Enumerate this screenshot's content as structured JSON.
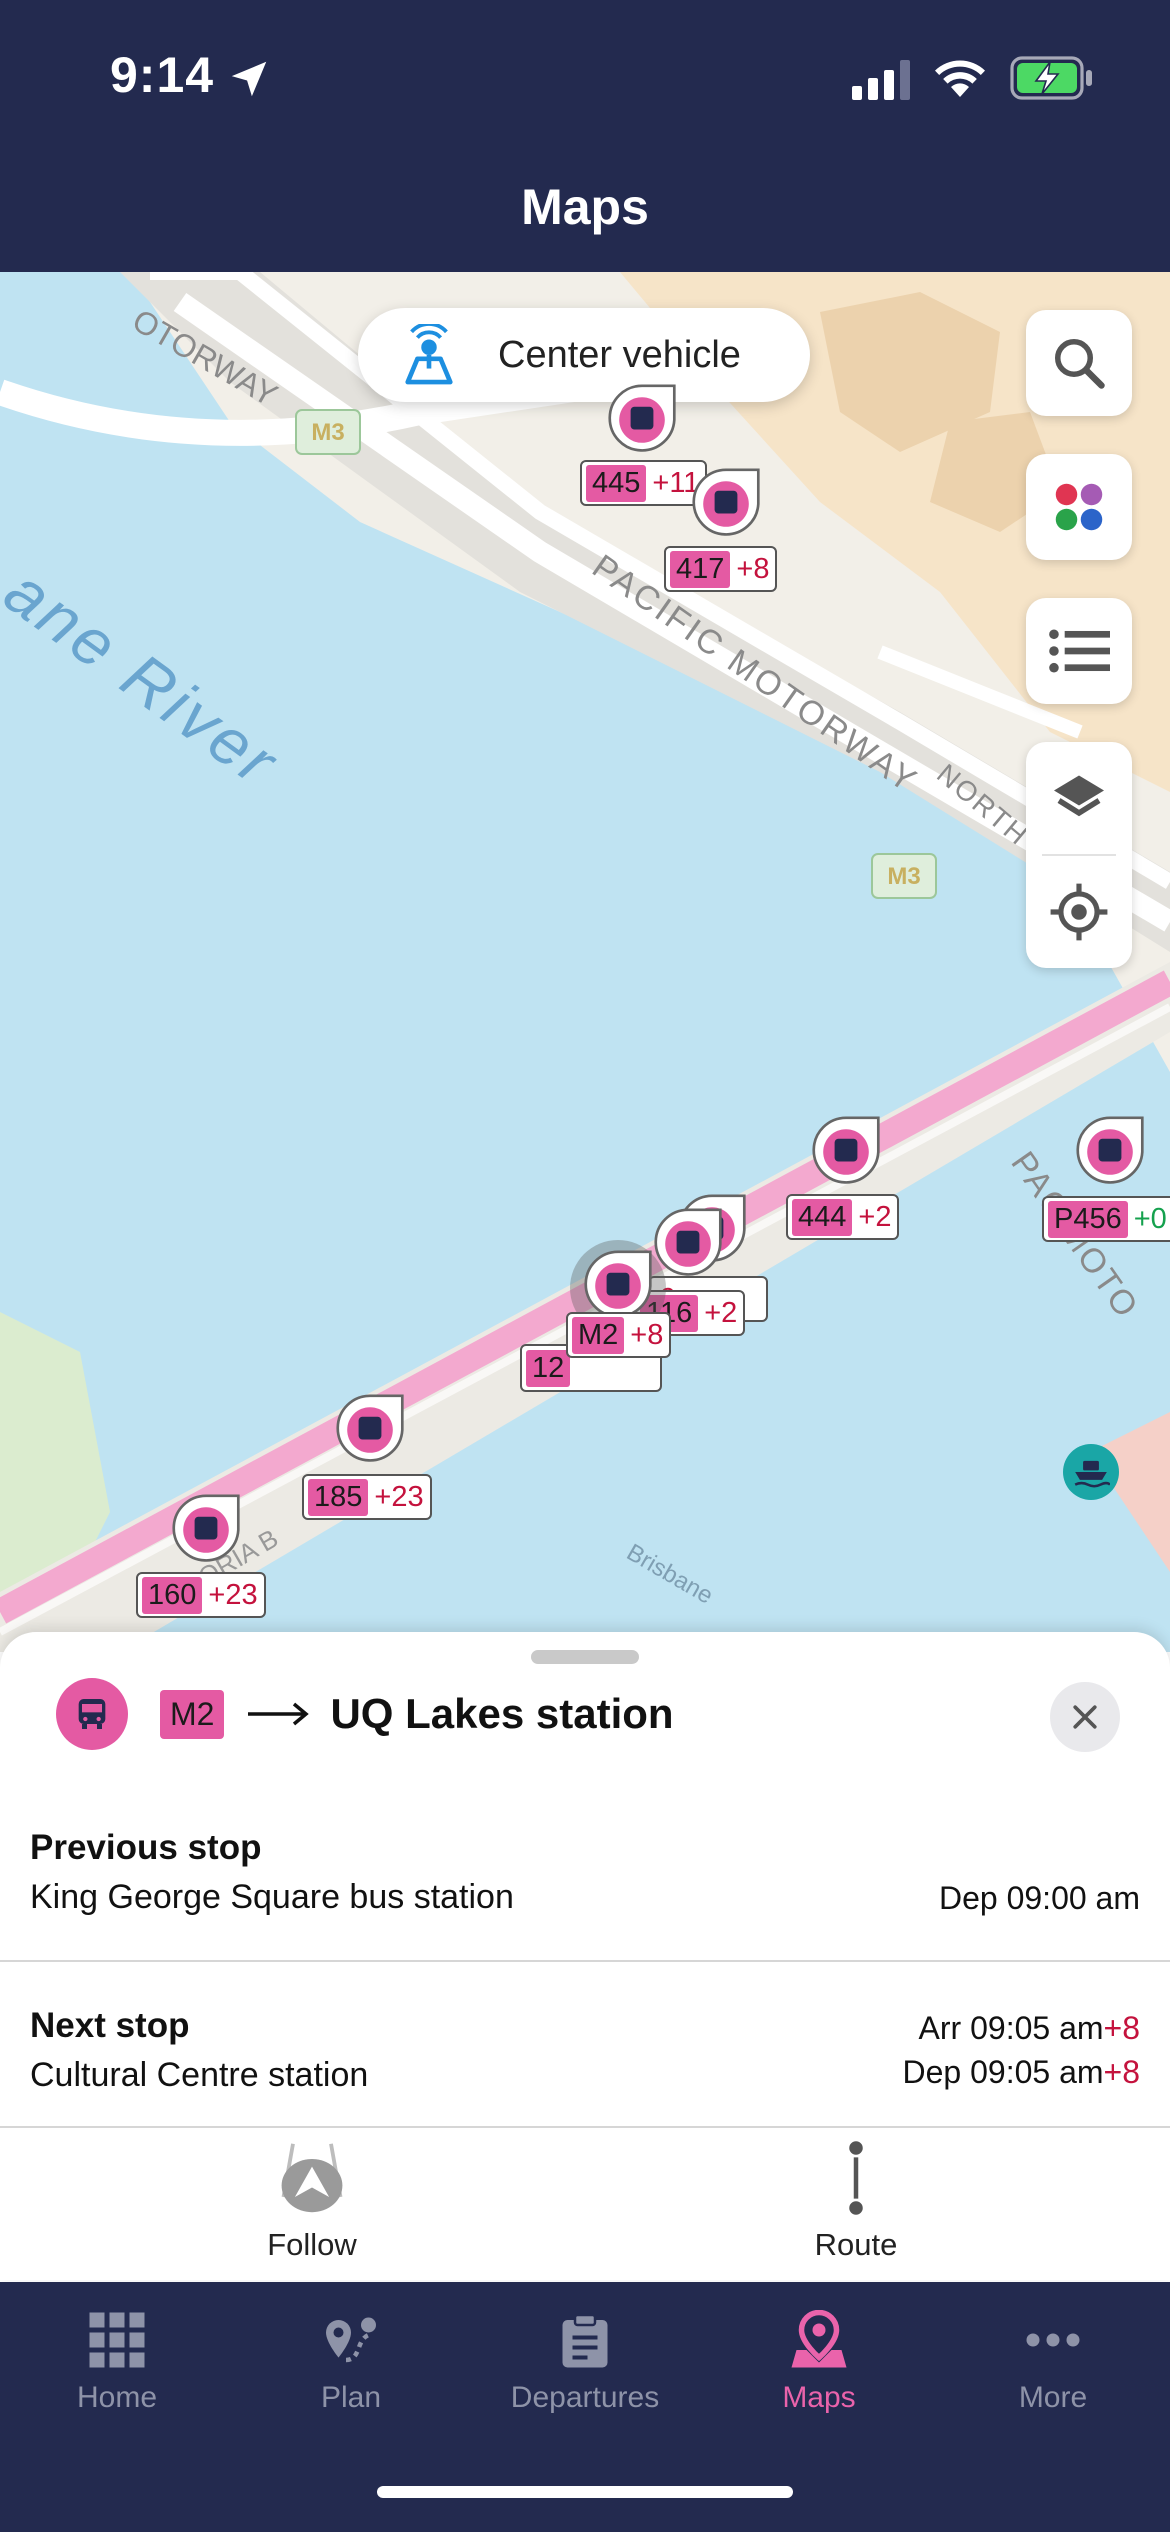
{
  "status_bar": {
    "time": "9:14"
  },
  "header": {
    "title": "Maps"
  },
  "map": {
    "center_vehicle_label": "Center vehicle",
    "road_labels": [
      "MOTORWAY",
      "PACIFIC MOTORWAY",
      "NORTH Q",
      "PAC MOTO",
      "ane River",
      "Brisbane",
      "ORIA B"
    ],
    "motorway_shield": "M3",
    "vehicles": [
      {
        "route": "445",
        "delay": "+11"
      },
      {
        "route": "417",
        "delay": "+8"
      },
      {
        "route": "444",
        "delay": "+2"
      },
      {
        "route": "P456",
        "delay": "+0"
      },
      {
        "route": "116",
        "delay": "+2"
      },
      {
        "route": "12",
        "delay": ""
      },
      {
        "route": "M2",
        "delay": "+8"
      },
      {
        "route": "185",
        "delay": "+23"
      },
      {
        "route": "160",
        "delay": "+23"
      }
    ]
  },
  "sheet": {
    "route": "M2",
    "destination": "UQ Lakes station",
    "previous_stop": {
      "heading": "Previous stop",
      "name": "King George Square bus station",
      "dep": "Dep 09:00 am"
    },
    "next_stop": {
      "heading": "Next stop",
      "name": "Cultural Centre station",
      "arr": "Arr 09:05 am",
      "arr_delay": "+8",
      "dep": "Dep 09:05 am",
      "dep_delay": "+8"
    },
    "actions": {
      "follow": "Follow",
      "route": "Route"
    }
  },
  "tabbar": {
    "items": [
      {
        "label": "Home"
      },
      {
        "label": "Plan"
      },
      {
        "label": "Departures"
      },
      {
        "label": "Maps"
      },
      {
        "label": "More"
      }
    ],
    "active": "Maps"
  },
  "colors": {
    "header_bg": "#232a4f",
    "accent_pink": "#e45aa3",
    "delay_red": "#c4123d",
    "water": "#bfe3f2"
  }
}
